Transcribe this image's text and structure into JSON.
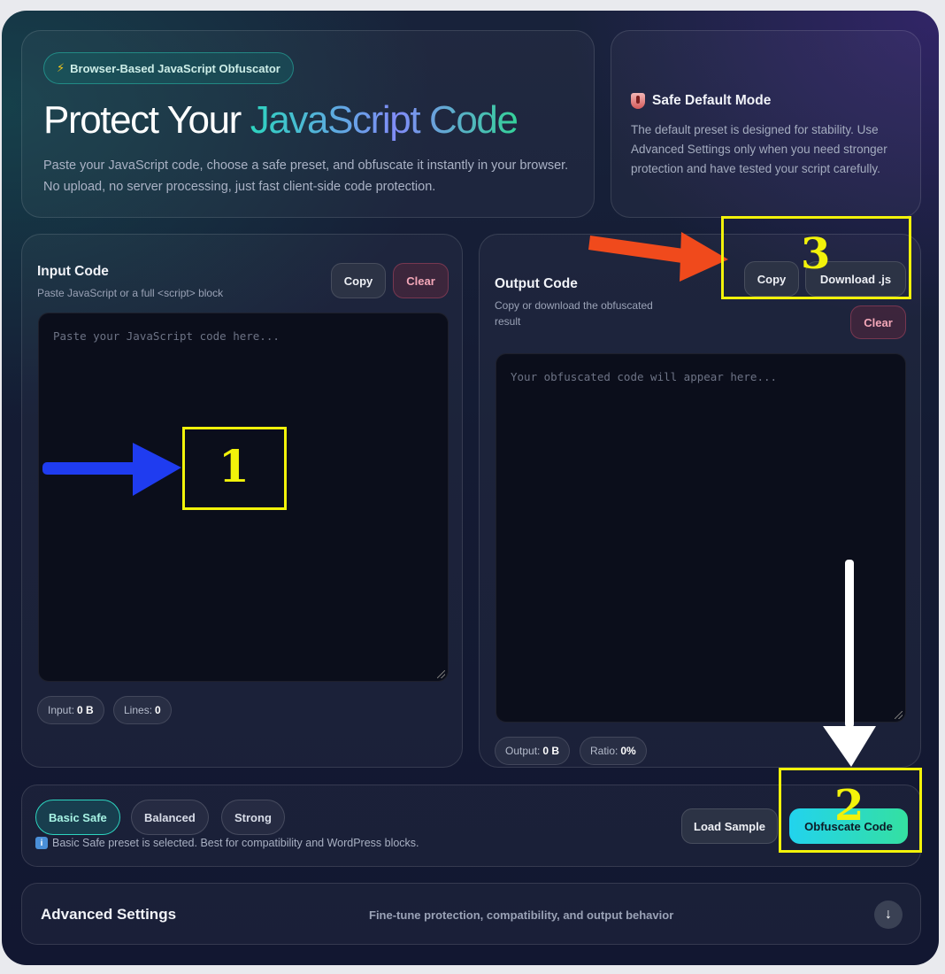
{
  "hero": {
    "badge_icon": "lightning-icon",
    "badge": "Browser-Based JavaScript Obfuscator",
    "title_plain": "Protect Your ",
    "title_accent": "JavaScript Code",
    "description": "Paste your JavaScript code, choose a safe preset, and obfuscate it instantly in your browser. No upload, no server processing, just fast client-side code protection."
  },
  "info": {
    "icon": "shield-icon",
    "title": "Safe Default Mode",
    "text": "The default preset is designed for stability. Use Advanced Settings only when you need stronger protection and have tested your script carefully."
  },
  "input_panel": {
    "title": "Input Code",
    "subtitle": "Paste JavaScript or a full <script> block",
    "copy_label": "Copy",
    "clear_label": "Clear",
    "placeholder": "Paste your JavaScript code here...",
    "stats": [
      {
        "label": "Input:",
        "value": "0 B"
      },
      {
        "label": "Lines:",
        "value": "0"
      }
    ]
  },
  "output_panel": {
    "title": "Output Code",
    "subtitle": "Copy or download the obfuscated result",
    "copy_label": "Copy",
    "download_label": "Download .js",
    "clear_label": "Clear",
    "placeholder": "Your obfuscated code will appear here...",
    "stats": [
      {
        "label": "Output:",
        "value": "0 B"
      },
      {
        "label": "Ratio:",
        "value": "0%"
      }
    ]
  },
  "presets": {
    "items": [
      "Basic Safe",
      "Balanced",
      "Strong"
    ],
    "active": "Basic Safe",
    "note": "Basic Safe preset is selected. Best for compatibility and WordPress blocks.",
    "load_sample_label": "Load Sample",
    "obfuscate_label": "Obfuscate Code"
  },
  "advanced": {
    "title": "Advanced Settings",
    "subtitle": "Fine-tune protection, compatibility, and output behavior",
    "toggle_icon": "arrow-down-icon"
  },
  "annotations": {
    "step1": "1",
    "step2": "2",
    "step3": "3",
    "colors": {
      "box": "#f2f20a",
      "arrow_blue": "#1f3cf0",
      "arrow_red": "#f04a1c",
      "arrow_white": "#ffffff"
    }
  },
  "colors": {
    "accent_teal": "#2dd4bf",
    "accent_purple": "#818cf8",
    "danger": "#f3a7b8"
  }
}
